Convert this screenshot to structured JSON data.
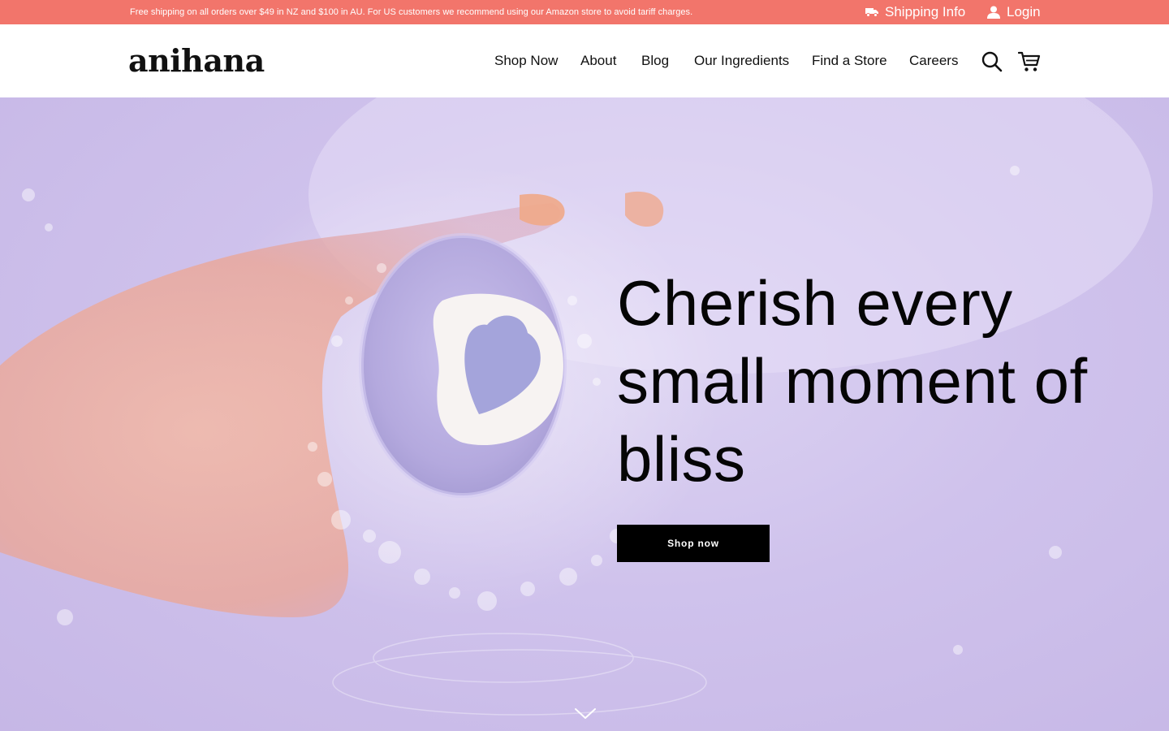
{
  "topbar": {
    "announcement": "Free shipping on all orders over $49 in NZ and $100 in AU. For US customers we recommend using our Amazon store to avoid tariff charges.",
    "shipping_label": "Shipping Info",
    "shipping_icon": "truck-icon",
    "login_label": "Login",
    "login_icon": "user-icon",
    "background_color": "#f2756b"
  },
  "header": {
    "logo": "anihana",
    "nav": [
      {
        "label": "Shop Now"
      },
      {
        "label": "About"
      },
      {
        "label": "Blog"
      },
      {
        "label": "Our Ingredients"
      },
      {
        "label": "Find a Store"
      },
      {
        "label": "Careers"
      }
    ],
    "icons": [
      "search-icon",
      "cart-icon"
    ]
  },
  "hero": {
    "headline": "Cherish every small moment of bliss",
    "button_label": "Shop now",
    "scroll_icon": "chevron-down-icon",
    "image": "hand holding lavender bath bomb with heart in water",
    "background_color": "#cfc2ec"
  }
}
